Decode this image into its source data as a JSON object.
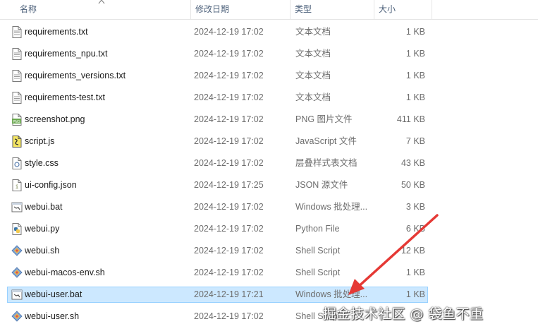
{
  "columns": {
    "name": "名称",
    "date": "修改日期",
    "type": "类型",
    "size": "大小"
  },
  "files": [
    {
      "name": "requirements.txt",
      "date": "2024-12-19 17:02",
      "type": "文本文档",
      "size": "1 KB",
      "icon": "text-file-icon"
    },
    {
      "name": "requirements_npu.txt",
      "date": "2024-12-19 17:02",
      "type": "文本文档",
      "size": "1 KB",
      "icon": "text-file-icon"
    },
    {
      "name": "requirements_versions.txt",
      "date": "2024-12-19 17:02",
      "type": "文本文档",
      "size": "1 KB",
      "icon": "text-file-icon"
    },
    {
      "name": "requirements-test.txt",
      "date": "2024-12-19 17:02",
      "type": "文本文档",
      "size": "1 KB",
      "icon": "text-file-icon"
    },
    {
      "name": "screenshot.png",
      "date": "2024-12-19 17:02",
      "type": "PNG 图片文件",
      "size": "411 KB",
      "icon": "png-file-icon"
    },
    {
      "name": "script.js",
      "date": "2024-12-19 17:02",
      "type": "JavaScript 文件",
      "size": "7 KB",
      "icon": "javascript-file-icon"
    },
    {
      "name": "style.css",
      "date": "2024-12-19 17:02",
      "type": "层叠样式表文档",
      "size": "43 KB",
      "icon": "css-file-icon"
    },
    {
      "name": "ui-config.json",
      "date": "2024-12-19 17:25",
      "type": "JSON 源文件",
      "size": "50 KB",
      "icon": "json-file-icon"
    },
    {
      "name": "webui.bat",
      "date": "2024-12-19 17:02",
      "type": "Windows 批处理...",
      "size": "3 KB",
      "icon": "batch-file-icon"
    },
    {
      "name": "webui.py",
      "date": "2024-12-19 17:02",
      "type": "Python File",
      "size": "6 KB",
      "icon": "python-file-icon"
    },
    {
      "name": "webui.sh",
      "date": "2024-12-19 17:02",
      "type": "Shell Script",
      "size": "12 KB",
      "icon": "shell-script-icon"
    },
    {
      "name": "webui-macos-env.sh",
      "date": "2024-12-19 17:02",
      "type": "Shell Script",
      "size": "1 KB",
      "icon": "shell-script-icon"
    },
    {
      "name": "webui-user.bat",
      "date": "2024-12-19 17:21",
      "type": "Windows 批处理...",
      "size": "1 KB",
      "icon": "batch-file-icon",
      "selected": true
    },
    {
      "name": "webui-user.sh",
      "date": "2024-12-19 17:02",
      "type": "Shell Script",
      "size": "",
      "icon": "shell-script-icon"
    }
  ],
  "watermark": "掘金技术社区 @ 袋鱼不重",
  "colors": {
    "selection_bg": "#cce8ff",
    "selection_border": "#99d1ff",
    "annotation_arrow": "#e53935"
  }
}
